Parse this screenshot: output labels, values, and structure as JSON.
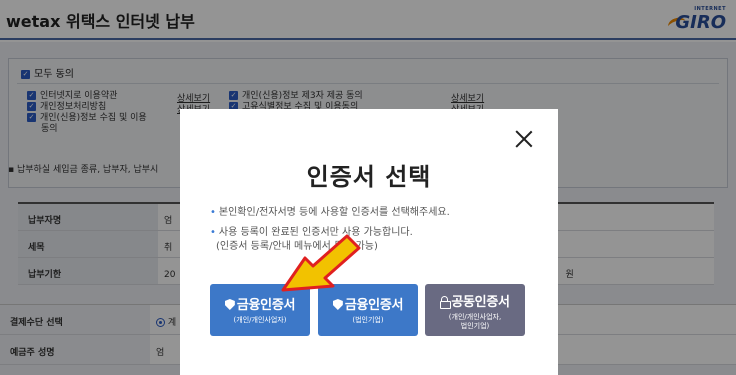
{
  "header": {
    "title": "wetax 위택스 인터넷 납부",
    "logo_small": "INTERNET",
    "logo_big": "GIRO"
  },
  "agreement": {
    "all_label": "모두 동의",
    "left_items": [
      "인터넷지로 이용약관",
      "개인정보처리방침",
      "개인(신용)정보 수집 및 이용",
      "동의"
    ],
    "right_items": [
      "개인(신용)정보 제3자 제공 동의",
      "고유식별정보 수집 및 이용동의"
    ],
    "detail_link": "상세보기"
  },
  "section_title": "납부하실 세입금 종류, 납부자, 납부시",
  "info_rows": [
    {
      "label": "납부자명",
      "value": "엄"
    },
    {
      "label": "세목",
      "value": "취"
    },
    {
      "label": "납부기한",
      "value": "20",
      "extra": "원"
    }
  ],
  "pay_rows": [
    {
      "label": "결제수단 선택",
      "value": "계"
    },
    {
      "label": "예금주 성명",
      "value": "엄"
    }
  ],
  "modal": {
    "title": "인증서 선택",
    "notices": [
      "본인확인/전자서명 등에 사용할 인증서를 선택해주세요.",
      "사용 등록이 완료된 인증서만 사용 가능합니다.",
      "(인증서 등록/안내 메뉴에서 등록 가능)"
    ],
    "buttons": [
      {
        "label": "금융인증서",
        "sub": "(개인/개인사업자)",
        "icon": "shield-icon"
      },
      {
        "label": "금융인증서",
        "sub": "(법인기업)",
        "icon": "shield-icon"
      },
      {
        "label": "공동인증서",
        "sub1": "(개인/개인사업자,",
        "sub2": "법인기업)",
        "icon": "lock-icon"
      }
    ]
  },
  "colors": {
    "blue_button": "#3d78c8",
    "gray_button": "#696a82",
    "arrow_fill": "#f2c200",
    "arrow_stroke": "#e02020"
  }
}
